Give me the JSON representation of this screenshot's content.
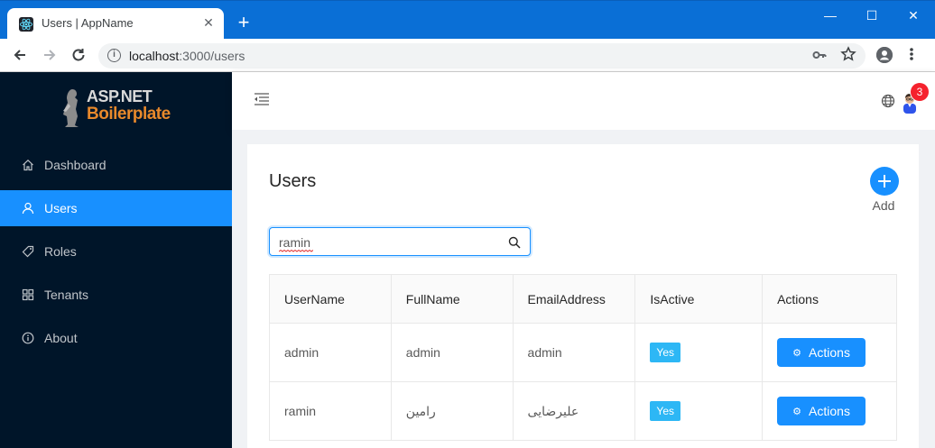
{
  "browser": {
    "tab_title": "Users | AppName",
    "tab_close": "✕",
    "new_tab": "+",
    "url_host": "localhost",
    "url_path": ":3000/users",
    "window_controls": {
      "minimize": "—",
      "maximize": "☐",
      "close": "✕"
    }
  },
  "sidebar": {
    "logo": {
      "line1": "ASP.NET",
      "line2": "Boilerplate"
    },
    "items": [
      {
        "label": "Dashboard",
        "icon": "home-icon",
        "active": false
      },
      {
        "label": "Users",
        "icon": "user-icon",
        "active": true
      },
      {
        "label": "Roles",
        "icon": "tag-icon",
        "active": false
      },
      {
        "label": "Tenants",
        "icon": "appstore-icon",
        "active": false
      },
      {
        "label": "About",
        "icon": "info-circle-icon",
        "active": false
      }
    ]
  },
  "header": {
    "notification_count": "3"
  },
  "page": {
    "title": "Users",
    "add_label": "Add",
    "search": {
      "value": "ramin",
      "placeholder": ""
    }
  },
  "table": {
    "columns": [
      "UserName",
      "FullName",
      "EmailAddress",
      "IsActive",
      "Actions"
    ],
    "rows": [
      {
        "username": "admin",
        "fullname": "admin",
        "email": "admin",
        "is_active": "Yes",
        "action_label": "Actions"
      },
      {
        "username": "ramin",
        "fullname": "رامین",
        "email": "علیرضایی",
        "is_active": "Yes",
        "action_label": "Actions"
      }
    ]
  },
  "colors": {
    "sidebar_bg": "#001529",
    "primary": "#1890ff",
    "tag_blue": "#2db7f5",
    "browser_blue": "#0a6fd6",
    "badge_red": "#f5222d",
    "logo_orange": "#e8892b"
  }
}
